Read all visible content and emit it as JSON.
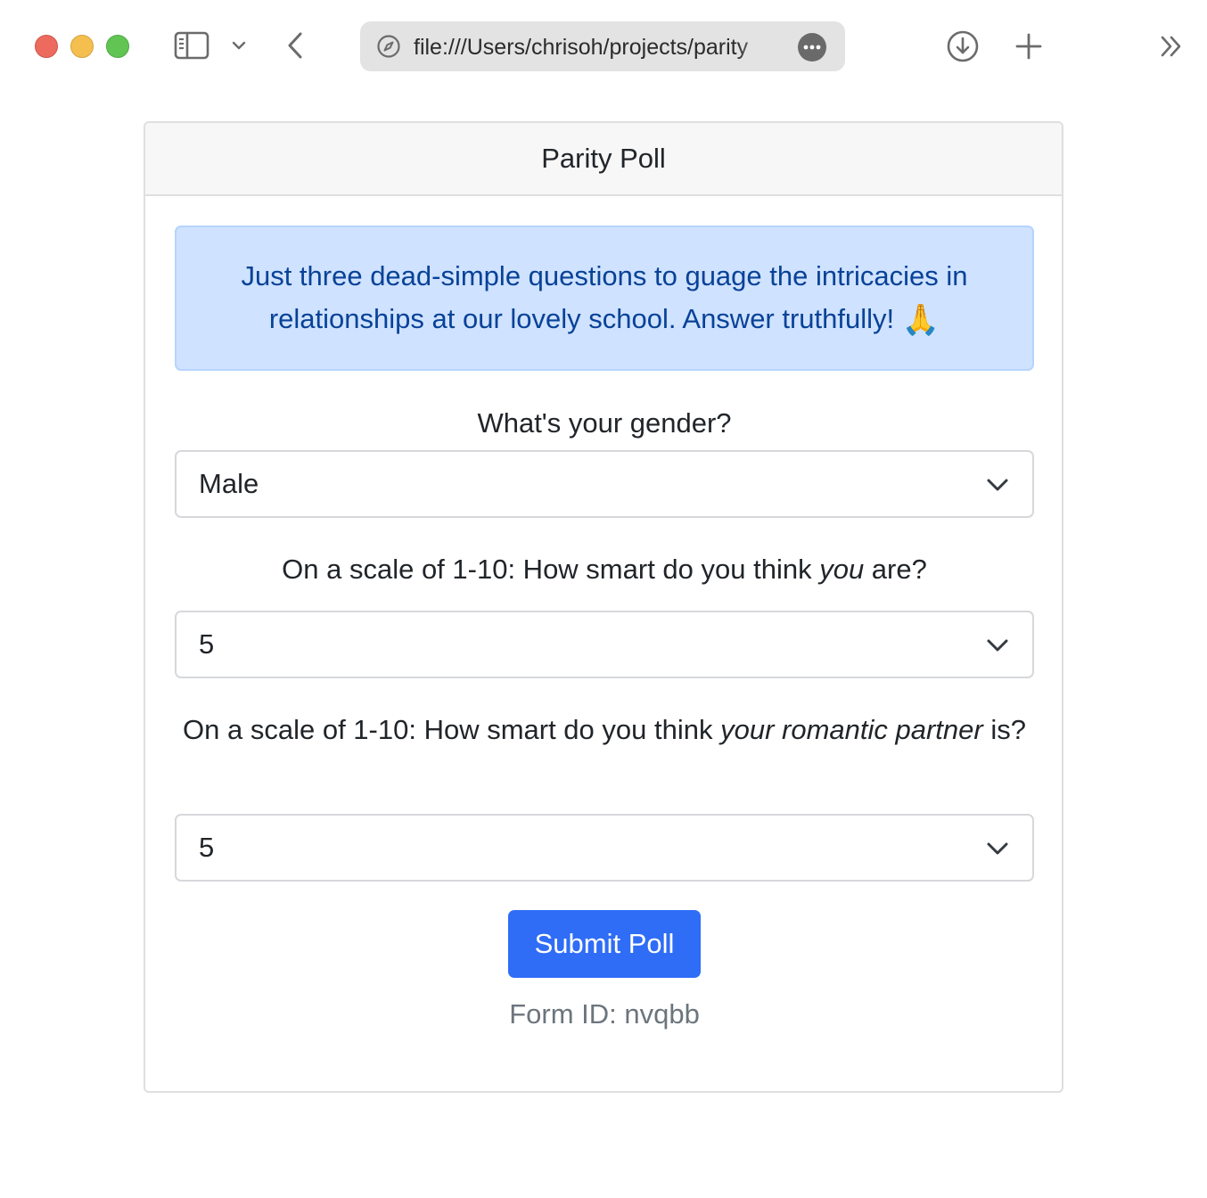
{
  "browser": {
    "url": "file:///Users/chrisoh/projects/parity",
    "icons": {
      "sidebar": "sidebar-icon",
      "sidebar_menu": "chevron-down-icon",
      "back": "chevron-left-icon",
      "site_info": "compass-icon",
      "page_menu": "more-icon",
      "downloads": "download-icon",
      "new_tab": "plus-icon",
      "overflow": "double-chevron-right-icon"
    }
  },
  "card": {
    "title": "Parity Poll",
    "intro_text": "Just three dead-simple questions to guage the intricacies in relationships at our lovely school. Answer truthfully!",
    "intro_emoji": "🙏"
  },
  "questions": {
    "gender": {
      "label": "What's your gender?",
      "selected": "Male"
    },
    "self_smart": {
      "label_before": "On a scale of 1-10: How smart do you think ",
      "label_emph": "you",
      "label_after": " are?",
      "selected": "5"
    },
    "partner_smart": {
      "label_before": "On a scale of 1-10: How smart do you think ",
      "label_emph": "your romantic partner",
      "label_after": " is?",
      "selected": "5"
    }
  },
  "submit_label": "Submit Poll",
  "form_id_text": "Form ID: nvqbb",
  "colors": {
    "primary": "#2f6df6",
    "alert_bg": "#cfe2ff",
    "alert_text": "#084298",
    "muted_text": "#6c757d"
  }
}
